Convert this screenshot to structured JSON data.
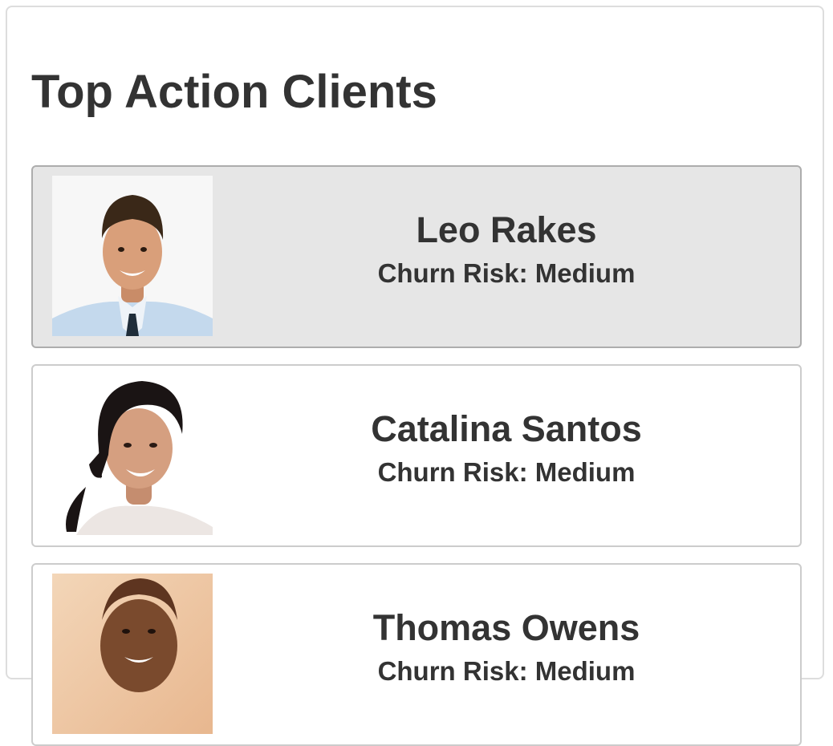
{
  "panel": {
    "title": "Top Action Clients"
  },
  "clients": [
    {
      "name": "Leo Rakes",
      "churn_risk": "Churn Risk: Medium",
      "photo": "male-headshot-photo",
      "selected": true
    },
    {
      "name": "Catalina Santos",
      "churn_risk": "Churn Risk: Medium",
      "photo": "female-headshot-photo",
      "selected": false
    },
    {
      "name": "Thomas Owens",
      "churn_risk": "Churn Risk: Medium",
      "photo": "male-headshot-photo",
      "selected": false
    }
  ],
  "colors": {
    "text": "#333333",
    "selected_background": "#e6e6e6",
    "card_border": "#cccccc",
    "panel_border": "#dddddd"
  }
}
